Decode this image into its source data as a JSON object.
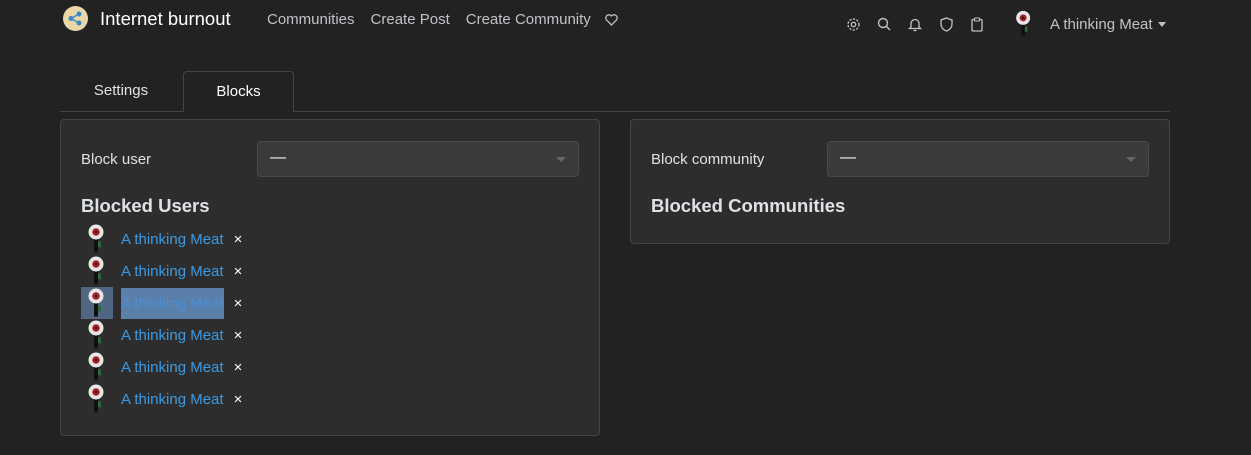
{
  "navbar": {
    "brand": "Internet burnout",
    "links": [
      "Communities",
      "Create Post",
      "Create Community"
    ],
    "icons": [
      "heart-icon",
      "gear-icon",
      "search-icon",
      "bell-icon",
      "shield-icon",
      "clipboard-icon"
    ],
    "user_name": "A thinking Meat"
  },
  "tabs": {
    "settings": "Settings",
    "blocks": "Blocks"
  },
  "block_user": {
    "label": "Block user",
    "selected": "—",
    "title": "Blocked Users",
    "users": [
      {
        "name": "A thinking Meat",
        "remove": "×"
      },
      {
        "name": "A thinking Meat",
        "remove": "×"
      },
      {
        "name": "A thinking Meat",
        "remove": "×"
      },
      {
        "name": "A thinking Meat",
        "remove": "×"
      },
      {
        "name": "A thinking Meat",
        "remove": "×"
      },
      {
        "name": "A thinking Meat",
        "remove": "×"
      }
    ]
  },
  "block_community": {
    "label": "Block community",
    "selected": "—",
    "title": "Blocked Communities"
  },
  "colors": {
    "background": "#222222",
    "card": "#2d2d2d",
    "link": "#3b9ae1",
    "selection": "#5a7fa8"
  }
}
